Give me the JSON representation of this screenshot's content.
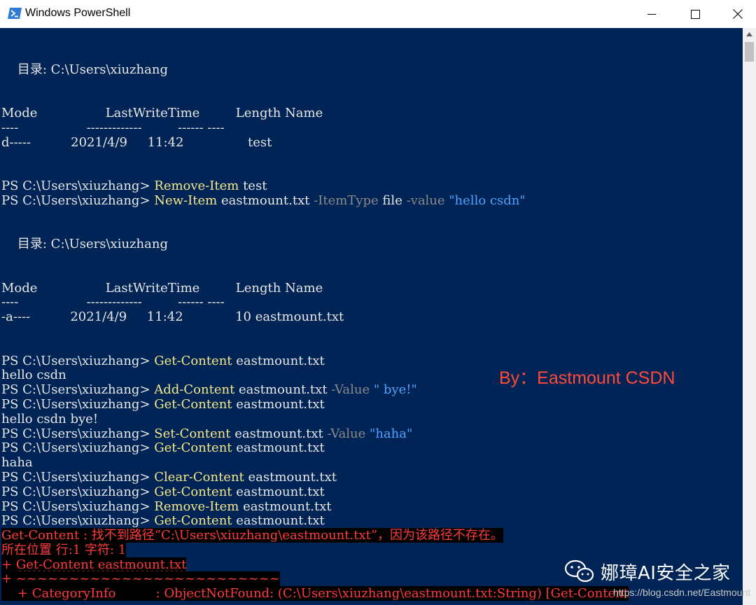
{
  "window": {
    "title": "Windows PowerShell",
    "icon": "powershell-icon",
    "controls": [
      "minimize-icon",
      "maximize-icon",
      "close-icon"
    ]
  },
  "console": {
    "colors": {
      "background": "#012456",
      "foreground": "#e8e8e8",
      "cmdlet": "#f5e98a",
      "parameter": "#8a8a8a",
      "string": "#4fa3ff",
      "error": "#ff3b3b"
    },
    "lines": [
      {
        "spans": [
          {
            "t": ""
          }
        ]
      },
      {
        "spans": [
          {
            "t": ""
          }
        ]
      },
      {
        "spans": [
          {
            "t": "    目录: C:\\Users\\xiuzhang"
          }
        ]
      },
      {
        "spans": [
          {
            "t": ""
          }
        ]
      },
      {
        "spans": [
          {
            "t": ""
          }
        ]
      },
      {
        "spans": [
          {
            "t": "Mode                 LastWriteTime         Length Name"
          }
        ]
      },
      {
        "spans": [
          {
            "t": "----                 -------------         ------ ----"
          }
        ]
      },
      {
        "spans": [
          {
            "t": "d-----          2021/4/9     11:42                test"
          }
        ]
      },
      {
        "spans": [
          {
            "t": ""
          }
        ]
      },
      {
        "spans": [
          {
            "t": ""
          }
        ]
      },
      {
        "spans": [
          {
            "t": "PS C:\\Users\\xiuzhang> "
          },
          {
            "t": "Remove-Item",
            "c": "c-y"
          },
          {
            "t": " test"
          }
        ]
      },
      {
        "spans": [
          {
            "t": "PS C:\\Users\\xiuzhang> "
          },
          {
            "t": "New-Item",
            "c": "c-y"
          },
          {
            "t": " eastmount.txt "
          },
          {
            "t": "-ItemType",
            "c": "c-g"
          },
          {
            "t": " file "
          },
          {
            "t": "-value",
            "c": "c-g"
          },
          {
            "t": " "
          },
          {
            "t": "\"hello csdn\"",
            "c": "c-s"
          }
        ]
      },
      {
        "spans": [
          {
            "t": ""
          }
        ]
      },
      {
        "spans": [
          {
            "t": ""
          }
        ]
      },
      {
        "spans": [
          {
            "t": "    目录: C:\\Users\\xiuzhang"
          }
        ]
      },
      {
        "spans": [
          {
            "t": ""
          }
        ]
      },
      {
        "spans": [
          {
            "t": ""
          }
        ]
      },
      {
        "spans": [
          {
            "t": "Mode                 LastWriteTime         Length Name"
          }
        ]
      },
      {
        "spans": [
          {
            "t": "----                 -------------         ------ ----"
          }
        ]
      },
      {
        "spans": [
          {
            "t": "-a----          2021/4/9     11:42             10 eastmount.txt"
          }
        ]
      },
      {
        "spans": [
          {
            "t": ""
          }
        ]
      },
      {
        "spans": [
          {
            "t": ""
          }
        ]
      },
      {
        "spans": [
          {
            "t": "PS C:\\Users\\xiuzhang> "
          },
          {
            "t": "Get-Content",
            "c": "c-y"
          },
          {
            "t": " eastmount.txt"
          }
        ]
      },
      {
        "spans": [
          {
            "t": "hello csdn"
          }
        ]
      },
      {
        "spans": [
          {
            "t": "PS C:\\Users\\xiuzhang> "
          },
          {
            "t": "Add-Content",
            "c": "c-y"
          },
          {
            "t": " eastmount.txt "
          },
          {
            "t": "-Value",
            "c": "c-g"
          },
          {
            "t": " "
          },
          {
            "t": "\" bye!\"",
            "c": "c-s"
          }
        ]
      },
      {
        "spans": [
          {
            "t": "PS C:\\Users\\xiuzhang> "
          },
          {
            "t": "Get-Content",
            "c": "c-y"
          },
          {
            "t": " eastmount.txt"
          }
        ]
      },
      {
        "spans": [
          {
            "t": "hello csdn bye!"
          }
        ]
      },
      {
        "spans": [
          {
            "t": "PS C:\\Users\\xiuzhang> "
          },
          {
            "t": "Set-Content",
            "c": "c-y"
          },
          {
            "t": " eastmount.txt "
          },
          {
            "t": "-Value",
            "c": "c-g"
          },
          {
            "t": " "
          },
          {
            "t": "\"haha\"",
            "c": "c-s"
          }
        ]
      },
      {
        "spans": [
          {
            "t": "PS C:\\Users\\xiuzhang> "
          },
          {
            "t": "Get-Content",
            "c": "c-y"
          },
          {
            "t": " eastmount.txt"
          }
        ]
      },
      {
        "spans": [
          {
            "t": "haha"
          }
        ]
      },
      {
        "spans": [
          {
            "t": "PS C:\\Users\\xiuzhang> "
          },
          {
            "t": "Clear-Content",
            "c": "c-y"
          },
          {
            "t": " eastmount.txt"
          }
        ]
      },
      {
        "spans": [
          {
            "t": "PS C:\\Users\\xiuzhang> "
          },
          {
            "t": "Get-Content",
            "c": "c-y"
          },
          {
            "t": " eastmount.txt"
          }
        ]
      },
      {
        "spans": [
          {
            "t": "PS C:\\Users\\xiuzhang> "
          },
          {
            "t": "Remove-Item",
            "c": "c-y"
          },
          {
            "t": " eastmount.txt"
          }
        ]
      },
      {
        "spans": [
          {
            "t": "PS C:\\Users\\xiuzhang> "
          },
          {
            "t": "Get-Content",
            "c": "c-y"
          },
          {
            "t": " eastmount.txt"
          }
        ]
      },
      {
        "spans": [
          {
            "t": "Get-Content : 找不到路径“C:\\Users\\xiuzhang\\eastmount.txt”，因为该路径不存在。",
            "c": "err"
          }
        ]
      },
      {
        "spans": [
          {
            "t": "所在位置 行:1 字符: 1",
            "c": "err"
          }
        ]
      },
      {
        "spans": [
          {
            "t": "+ ",
            "c": "err"
          },
          {
            "t": "Get-Content eastmount.txt",
            "c": "err wavy"
          }
        ]
      },
      {
        "spans": [
          {
            "t": "+ ",
            "c": "err"
          },
          {
            "t": "~~~~~~~~~~~~~~~~~~~~~~~~~",
            "c": "err"
          }
        ]
      },
      {
        "spans": [
          {
            "t": "    + CategoryInfo          : ObjectNotFound: (C:\\Users\\xiuzhang\\eastmount.txt:String) [Get-Content",
            "c": "err"
          }
        ]
      }
    ]
  },
  "overlay": {
    "banner": "By：Eastmount CSDN",
    "watermark_name": "娜璋AI安全之家",
    "watermark_icon": "wechat-icon",
    "blog_watermark": "https://blog.csdn.net/Eastmount"
  }
}
